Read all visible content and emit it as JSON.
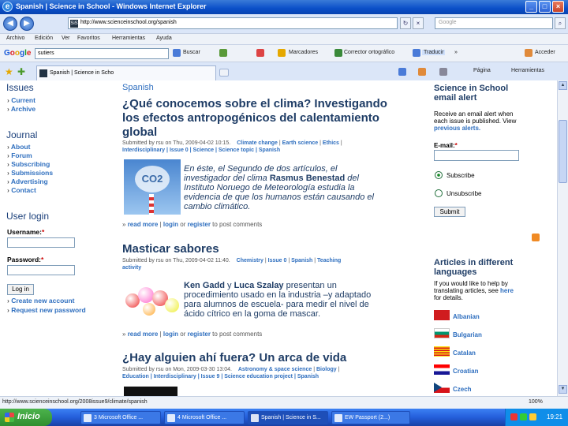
{
  "window": {
    "title": "Spanish | Science in School - Windows Internet Explorer",
    "ie_letter": "e",
    "min": "_",
    "max": "□",
    "close": "×"
  },
  "addressbar": {
    "url": "http://www.scienceinschool.org/spanish",
    "back": "◀",
    "forward": "▶",
    "search_placeholder": "Google"
  },
  "menu": [
    "Archivo",
    "Edición",
    "Ver",
    "Favoritos",
    "Herramientas",
    "Ayuda"
  ],
  "google_toolbar": {
    "logo": [
      "G",
      "o",
      "o",
      "g",
      "l",
      "e"
    ],
    "query": "sutiers",
    "items": [
      "Buscar",
      "Marcadores",
      "Corrector ortográfico",
      "Traducir",
      "»",
      "Acceder"
    ]
  },
  "tabs": {
    "active_tab": "Spanish | Science in Scho",
    "commands": [
      "Página",
      "Herramientas"
    ]
  },
  "sidebar": {
    "issues_heading": "Issues",
    "issues_links": [
      "Current",
      "Archive"
    ],
    "journal_heading": "Journal",
    "journal_links": [
      "About",
      "Forum",
      "Subscribing",
      "Submissions",
      "Advertising",
      "Contact"
    ],
    "login_heading": "User login",
    "username_label": "Username:",
    "password_label": "Password:",
    "required_mark": "*",
    "login_button": "Log in",
    "account_links": [
      "Create new account",
      "Request new password"
    ]
  },
  "main": {
    "section": "Spanish",
    "articles": [
      {
        "title_lines": [
          "¿Qué conocemos sobre el clima? Investigando",
          "los efectos antropogénicos del calentamiento",
          "global"
        ],
        "meta": "Submitted by rsu on Thu, 2009-04-02 10:15.",
        "tags_line1": [
          "Climate change",
          "Earth science",
          "Ethics"
        ],
        "tags_line2": [
          "Interdisciplinary",
          "Issue 0",
          "Science",
          "Science topic",
          "Spanish"
        ],
        "teaser_lines": [
          "En éste, el Segundo de dos artículos, el",
          "investigador del clima ",
          "Rasmus Benestad",
          " del",
          "Instituto Noruego de Meteorología estudia la",
          "evidencia de que los humanos están causando el",
          "cambio climático."
        ],
        "image_text": "CO2"
      },
      {
        "title_lines": [
          "Masticar sabores"
        ],
        "meta": "Submitted by rsu on Thu, 2009-04-02 11:40.",
        "tags_line1": [
          "Chemistry",
          "Issue 0",
          "Spanish",
          "Teaching"
        ],
        "tags_line2": [
          "activity"
        ],
        "teaser_lines": [
          "Ken Gadd",
          " y ",
          "Luca Szalay",
          " presentan un",
          "procedimiento usado en la industria –y adaptado",
          "para alumnos de escuela- para medir el nivel de",
          "ácido cítrico en la goma de mascar."
        ]
      },
      {
        "title_lines": [
          "¿Hay alguien ahí fuera? Un arca de vida"
        ],
        "meta": "Submitted by rsu on Mon, 2009-03-30 13:04.",
        "tags_line1": [
          "Astronomy & space science",
          "Biology"
        ],
        "tags_line2": [
          "Education",
          "Interdisciplinary",
          "Issue 9",
          "Science education project",
          "Spanish"
        ]
      }
    ],
    "readmore": {
      "read_more": "read more",
      "sep": " | ",
      "login": "login",
      "or": " or ",
      "register": "register",
      "suffix": " to post comments",
      "bullet": "»"
    }
  },
  "right": {
    "alert_heading": [
      "Science in School",
      "email alert"
    ],
    "alert_text": [
      "Receive an email alert when",
      "each issue is published. View"
    ],
    "alert_link": "previous alerts.",
    "email_label": "E-mail:",
    "required_mark": "*",
    "subscribe": "Subscribe",
    "unsubscribe": "Unsubscribe",
    "submit": "Submit",
    "lang_heading": [
      "Articles in different",
      "languages"
    ],
    "lang_text": [
      "If you would like to help by",
      "translating articles, see ",
      "for details."
    ],
    "lang_link": "here",
    "languages": [
      "Albanian",
      "Bulgarian",
      "Catalan",
      "Croatian",
      "Czech"
    ]
  },
  "status": {
    "text": "http://www.scienceinschool.org/2008issue9/climate/spanish",
    "zoom": "100%"
  },
  "taskbar": {
    "start": "Inicio",
    "tasks": [
      "3 Microsoft Office ...",
      "4 Microsoft Office ...",
      "Spanish | Science in S...",
      "EW Passport (2...)"
    ],
    "clock": "19:21"
  }
}
